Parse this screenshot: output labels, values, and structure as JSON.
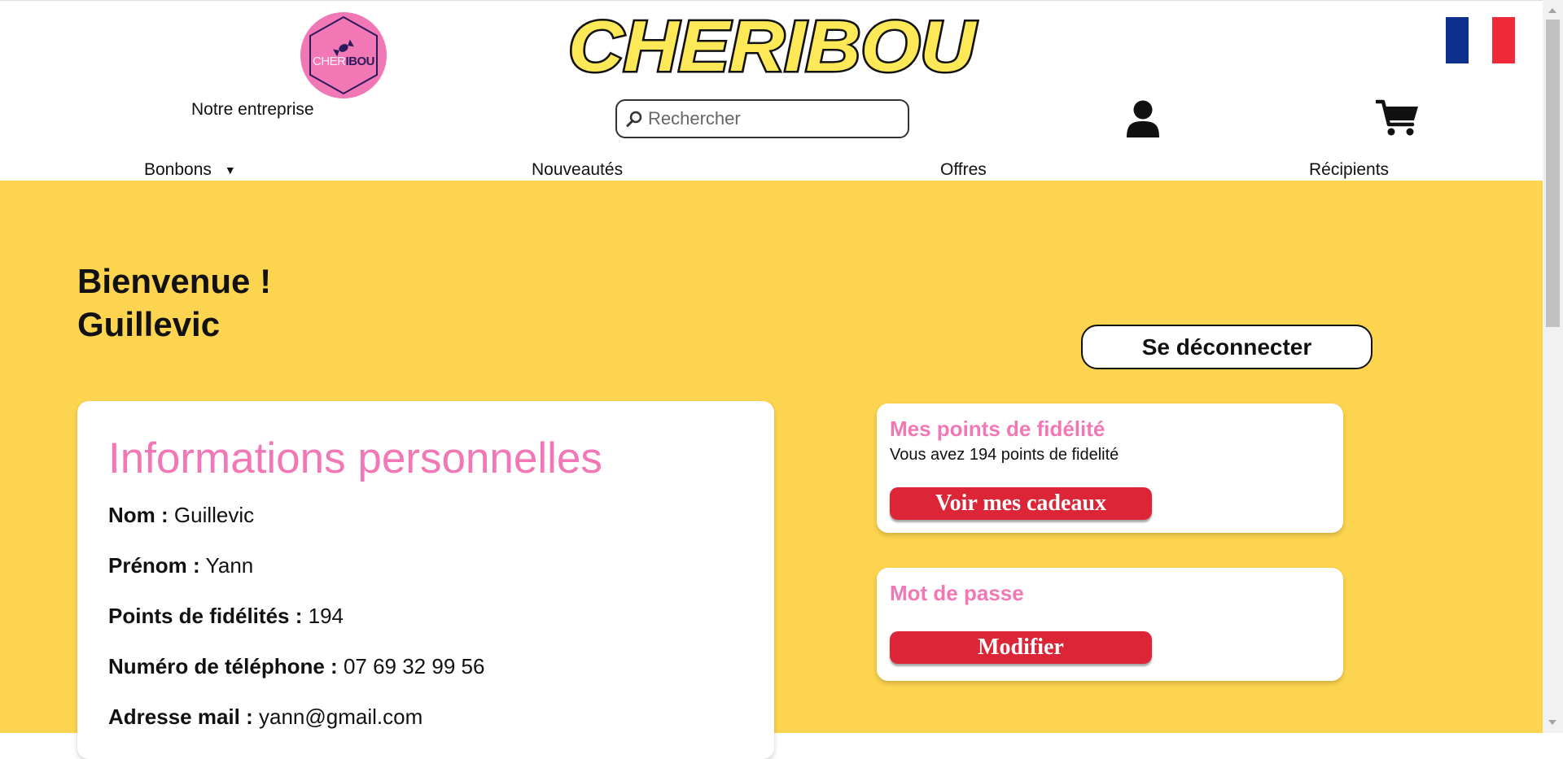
{
  "header": {
    "logo_text_1": "CHER",
    "logo_text_2": "IBOU",
    "company_link": "Notre entreprise",
    "brand": "CHERIBOU",
    "search_placeholder": "Rechercher",
    "flag_colors": [
      "#0f2f8f",
      "#ffffff",
      "#ee2a39"
    ]
  },
  "nav": {
    "items": [
      "Bonbons",
      "Nouveautés",
      "Offres",
      "Récipients"
    ],
    "caret": "▼"
  },
  "welcome": {
    "line1": "Bienvenue !",
    "line2": "Guillevic"
  },
  "logout_label": "Se déconnecter",
  "personal_info": {
    "title": "Informations personnelles",
    "rows": [
      {
        "label": "Nom :",
        "value": "Guillevic"
      },
      {
        "label": "Prénom :",
        "value": "Yann"
      },
      {
        "label": "Points de fidélités :",
        "value": "194"
      },
      {
        "label": "Numéro de téléphone :",
        "value": "07 69 32 99 56"
      },
      {
        "label": "Adresse mail :",
        "value": "yann@gmail.com"
      }
    ]
  },
  "loyalty": {
    "title": "Mes points de fidélité",
    "text": "Vous avez 194 points de fidelité",
    "button": "Voir mes cadeaux"
  },
  "password": {
    "title": "Mot de passe",
    "button": "Modifier"
  },
  "colors": {
    "accent_yellow": "#fdd44f",
    "pink": "#f277b5",
    "red_button": "#dc2638"
  }
}
